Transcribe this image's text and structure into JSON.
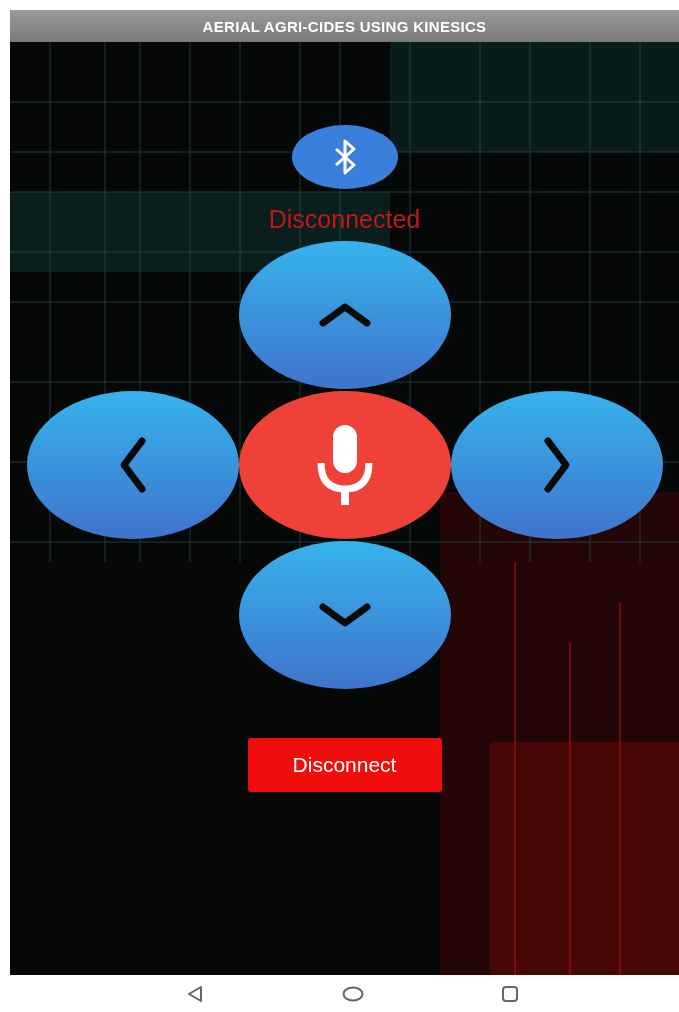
{
  "app_bar": {
    "title": "AERIAL AGRI-CIDES USING KINESICS"
  },
  "status": {
    "text": "Disconnected"
  },
  "controls": [
    {
      "kind": "up"
    },
    {
      "kind": "left"
    },
    {
      "kind": "mic"
    },
    {
      "kind": "right"
    },
    {
      "kind": "down"
    }
  ],
  "disconnect_button": {
    "label": "Disconnect"
  },
  "nav_bar": [
    {
      "kind": "back"
    },
    {
      "kind": "home"
    },
    {
      "kind": "recents"
    }
  ]
}
